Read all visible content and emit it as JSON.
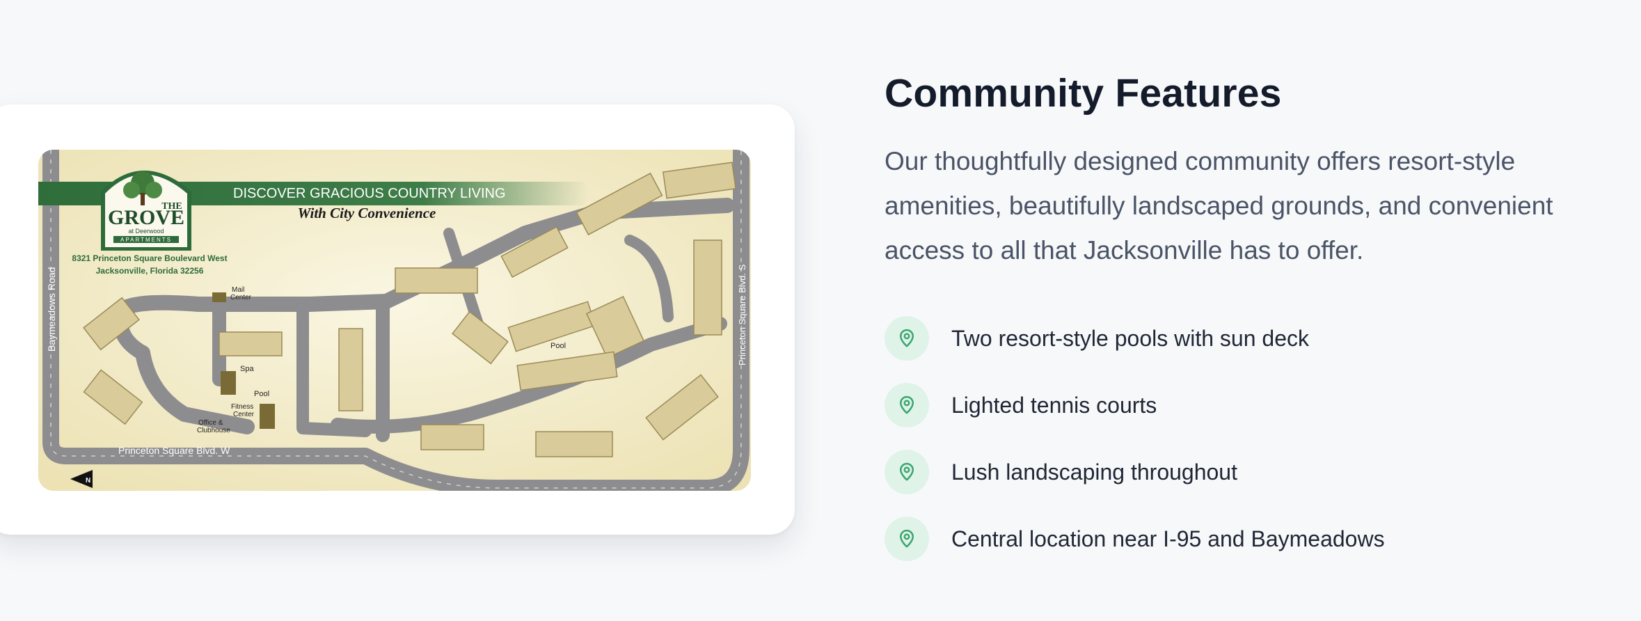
{
  "map": {
    "alt": "The Grove at Deerwood Apartments site map",
    "logo": {
      "the": "THE",
      "grove": "GROVE",
      "at_deerwood": "at Deerwood",
      "apartments": "APARTMENTS"
    },
    "banner": "DISCOVER GRACIOUS COUNTRY LIVING",
    "tagline": "With City Convenience",
    "address_line1": "8321 Princeton Square Boulevard West",
    "address_line2": "Jacksonville, Florida 32256",
    "labels": {
      "baymeadows_road": "Baymeadows Road",
      "princeton_w": "Princeton Square Blvd. W",
      "princeton_s": "Princeton Square Blvd. S",
      "mail_center_1": "Mail",
      "mail_center_2": "Center",
      "spa": "Spa",
      "pool_left": "Pool",
      "pool_center": "Pool",
      "fitness_1": "Fitness",
      "fitness_2": "Center",
      "office_1": "Office &",
      "office_2": "Clubhouse",
      "north": "N"
    },
    "colors": {
      "road": "#8d8d8f",
      "building": "#d9cc9a",
      "background": "#f3ecc9",
      "brand_green": "#2e6b3a"
    }
  },
  "features_section": {
    "title": "Community Features",
    "description": "Our thoughtfully designed community offers resort-style amenities, beautifully landscaped grounds, and convenient access to all that Jacksonville has to offer.",
    "accent_color": "#3aa56e",
    "items": [
      {
        "icon": "map-pin-icon",
        "text": "Two resort-style pools with sun deck"
      },
      {
        "icon": "map-pin-icon",
        "text": "Lighted tennis courts"
      },
      {
        "icon": "map-pin-icon",
        "text": "Lush landscaping throughout"
      },
      {
        "icon": "map-pin-icon",
        "text": "Central location near I-95 and Baymeadows"
      }
    ]
  }
}
